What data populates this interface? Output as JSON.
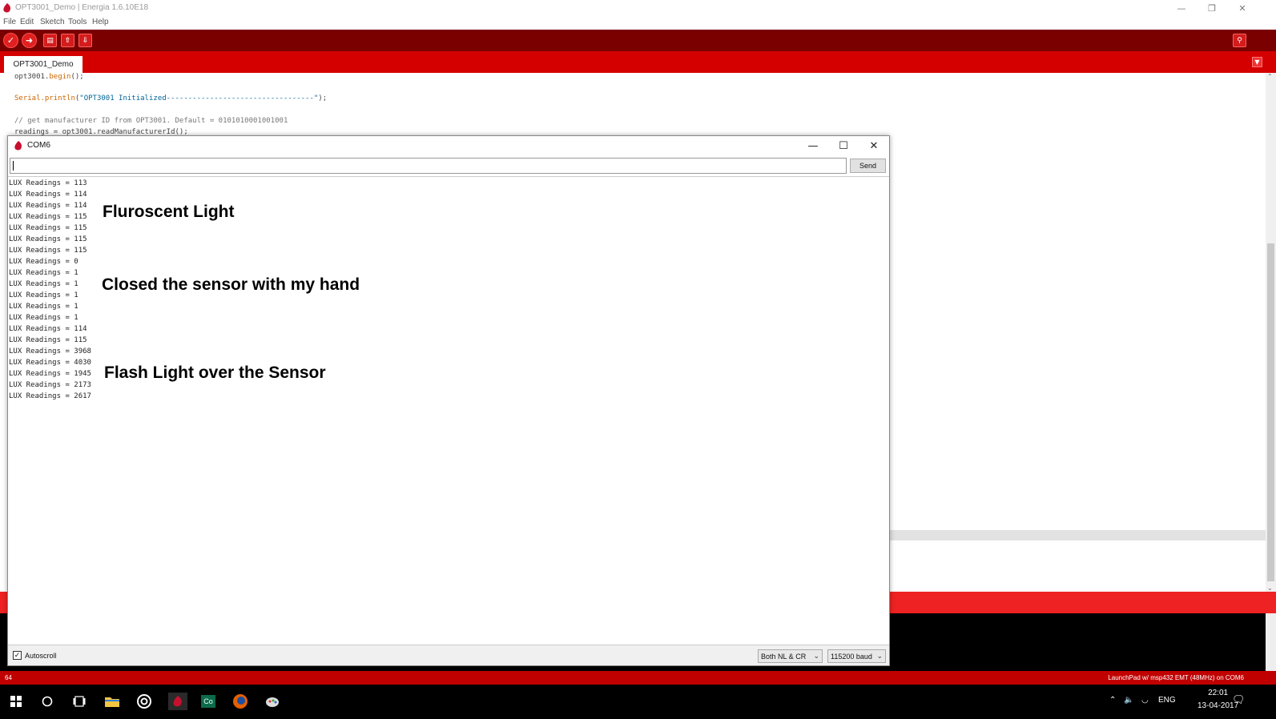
{
  "ide": {
    "title": "OPT3001_Demo | Energia 1.6.10E18",
    "menu": [
      "File",
      "Edit",
      "Sketch",
      "Tools",
      "Help"
    ],
    "tab": "OPT3001_Demo",
    "code": {
      "line1_obj": "opt3001.",
      "line1_fn": "begin",
      "line1_end": "();",
      "line2_fn": "Serial.println",
      "line2_open": "(",
      "line2_str": "\"OPT3001 Initialized----------------------------------\"",
      "line2_end": ");",
      "line3": "// get manufacturer ID from OPT3001. Default = 0101010001001001",
      "line4": "readings = opt3001.readManufacturerId();"
    },
    "status_left": "64",
    "status_right": "LaunchPad w/ msp432 EMT (48MHz) on COM6"
  },
  "serial": {
    "title": "COM6",
    "input_value": "",
    "send_label": "Send",
    "lines": [
      "LUX Readings = 113",
      "LUX Readings = 114",
      "LUX Readings = 114",
      "LUX Readings = 115",
      "LUX Readings = 115",
      "LUX Readings = 115",
      "LUX Readings = 115",
      "LUX Readings = 0",
      "LUX Readings = 1",
      "LUX Readings = 1",
      "LUX Readings = 1",
      "LUX Readings = 1",
      "LUX Readings = 1",
      "LUX Readings = 114",
      "LUX Readings = 115",
      "LUX Readings = 3968",
      "LUX Readings = 4030",
      "LUX Readings = 1945",
      "LUX Readings = 2173",
      "LUX Readings = 2617"
    ],
    "annotations": {
      "fluorescent": "Fluroscent Light",
      "closed": "Closed the sensor with my hand",
      "flash": "Flash Light over the Sensor"
    },
    "autoscroll_label": "Autoscroll",
    "autoscroll_checked": true,
    "line_ending": "Both NL & CR",
    "baud": "115200 baud"
  },
  "taskbar": {
    "lang": "ENG",
    "time": "22:01",
    "date": "13-04-2017",
    "app_label": "Co"
  },
  "colors": {
    "toolbar": "#7a0000",
    "tabbar": "#d40000",
    "message_bar": "#ee2222",
    "status_bar": "#c00000"
  }
}
